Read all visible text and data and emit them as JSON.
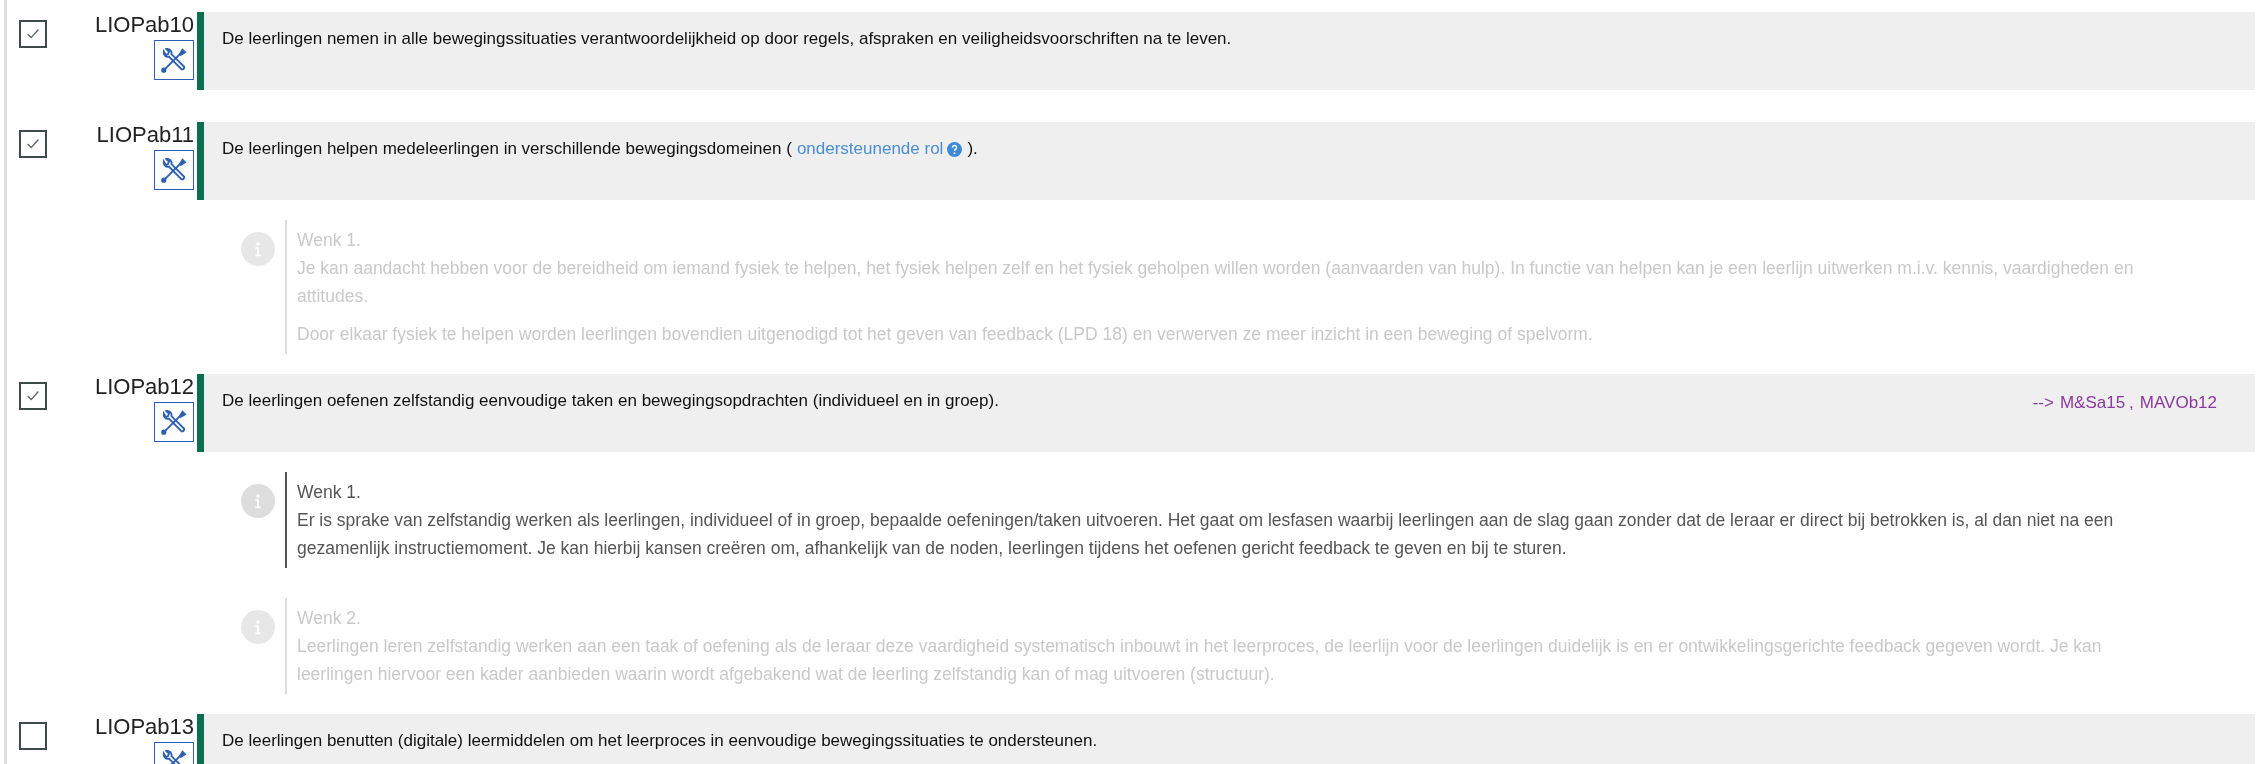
{
  "items": [
    {
      "code": "LIOPab10",
      "checked": true,
      "text": "De leerlingen nemen in alle bewegingssituaties verantwoordelijkheid op door regels, afspraken en veiligheidsvoorschriften na te leven."
    },
    {
      "code": "LIOPab11",
      "checked": true,
      "text": "De leerlingen helpen medeleerlingen in verschillende bewegingsdomeinen (",
      "link": "ondersteunende rol",
      "text_after": ").",
      "notes": [
        {
          "title": "Wenk 1.",
          "highlighted": false,
          "paragraphs": [
            "Je kan aandacht hebben voor de bereidheid om iemand fysiek te helpen, het fysiek helpen zelf en het fysiek geholpen willen worden (aanvaarden van hulp). In functie van helpen kan je een leerlijn uitwerken m.i.v. kennis, vaardigheden en attitudes.",
            "Door elkaar fysiek te helpen worden leerlingen bovendien uitgenodigd tot het geven van feedback (LPD 18) en verwerven ze meer inzicht in een beweging of spelvorm."
          ]
        }
      ]
    },
    {
      "code": "LIOPab12",
      "checked": true,
      "text": "De leerlingen oefenen zelfstandig eenvoudige taken en bewegingsopdrachten (individueel en in groep).",
      "refs": {
        "arrow": "-->",
        "links": [
          "M&Sa15",
          "MAVOb12"
        ],
        "separator": ","
      },
      "notes": [
        {
          "title": "Wenk 1.",
          "highlighted": true,
          "paragraphs": [
            "Er is sprake van zelfstandig werken als leerlingen, individueel of in groep, bepaalde oefeningen/taken uitvoeren. Het gaat om lesfasen waarbij leerlingen aan de slag gaan zonder dat de leraar er direct bij betrokken is, al dan niet na een gezamenlijk instructiemoment. Je kan hierbij kansen creëren om, afhankelijk van de noden, leerlingen tijdens het oefenen gericht feedback te geven en bij te sturen."
          ]
        },
        {
          "title": "Wenk 2.",
          "highlighted": false,
          "paragraphs": [
            "Leerlingen leren zelfstandig werken aan een taak of oefening als de leraar deze vaardigheid systematisch inbouwt in het leerproces, de leerlijn voor de leerlingen duidelijk is en er ontwikkelingsgerichte feedback gegeven wordt. Je kan leerlingen hiervoor een kader aanbieden waarin wordt afgebakend wat de leerling zelfstandig kan of mag uitvoeren (structuur)."
          ]
        }
      ]
    },
    {
      "code": "LIOPab13",
      "checked": false,
      "text": "De leerlingen benutten (digitale) leermiddelen om het leerproces in eenvoudige bewegingssituaties te ondersteunen."
    }
  ]
}
